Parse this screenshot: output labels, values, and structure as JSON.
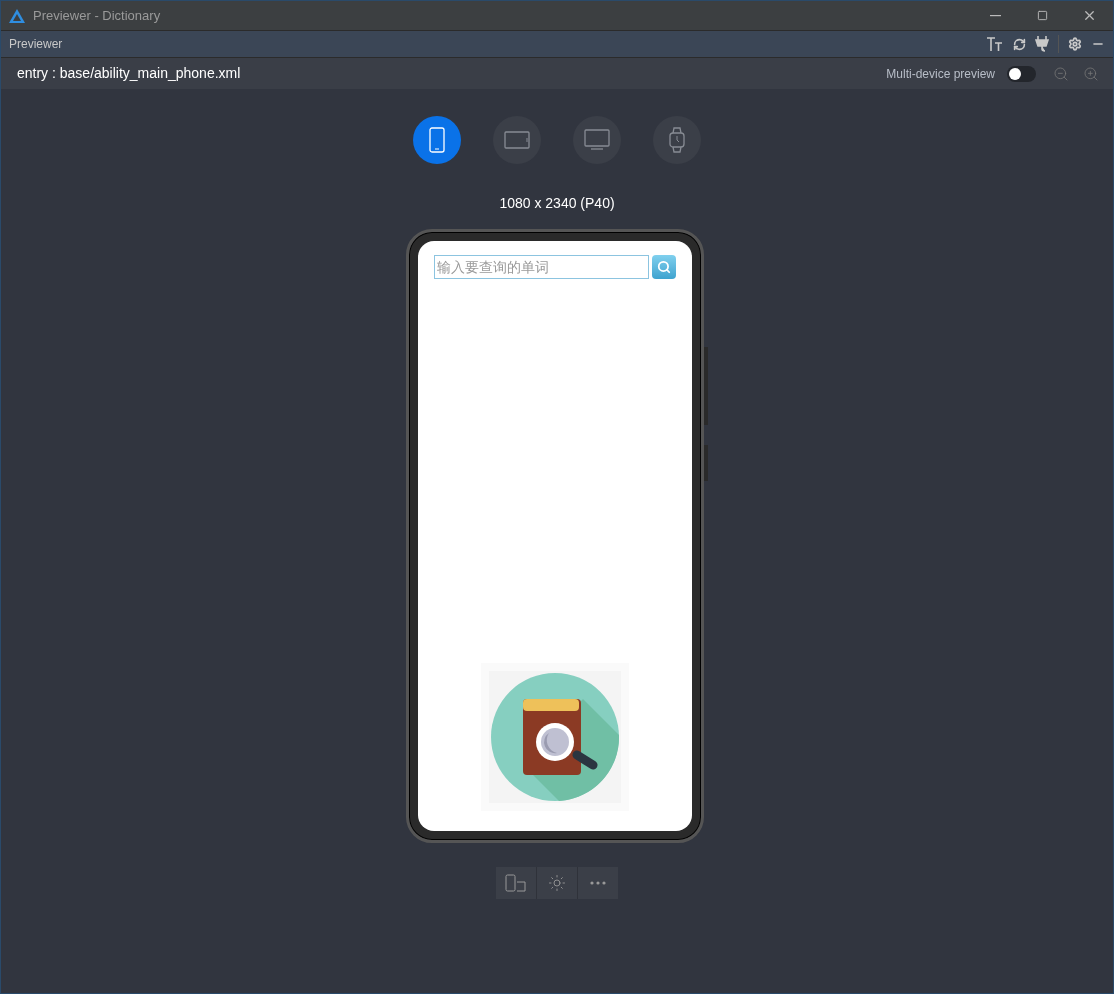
{
  "window": {
    "title": "Previewer - Dictionary"
  },
  "panel": {
    "title": "Previewer"
  },
  "toolbar": {
    "file": "entry : base/ability_main_phone.xml",
    "multi_device": {
      "label": "Multi-device preview",
      "on": false
    }
  },
  "devices": [
    {
      "kind": "phone",
      "selected": true
    },
    {
      "kind": "tablet",
      "selected": false
    },
    {
      "kind": "tv",
      "selected": false
    },
    {
      "kind": "watch",
      "selected": false
    }
  ],
  "resolution": "1080 x 2340 (P40)",
  "app": {
    "search": {
      "placeholder": "输入要查询的单词"
    }
  }
}
